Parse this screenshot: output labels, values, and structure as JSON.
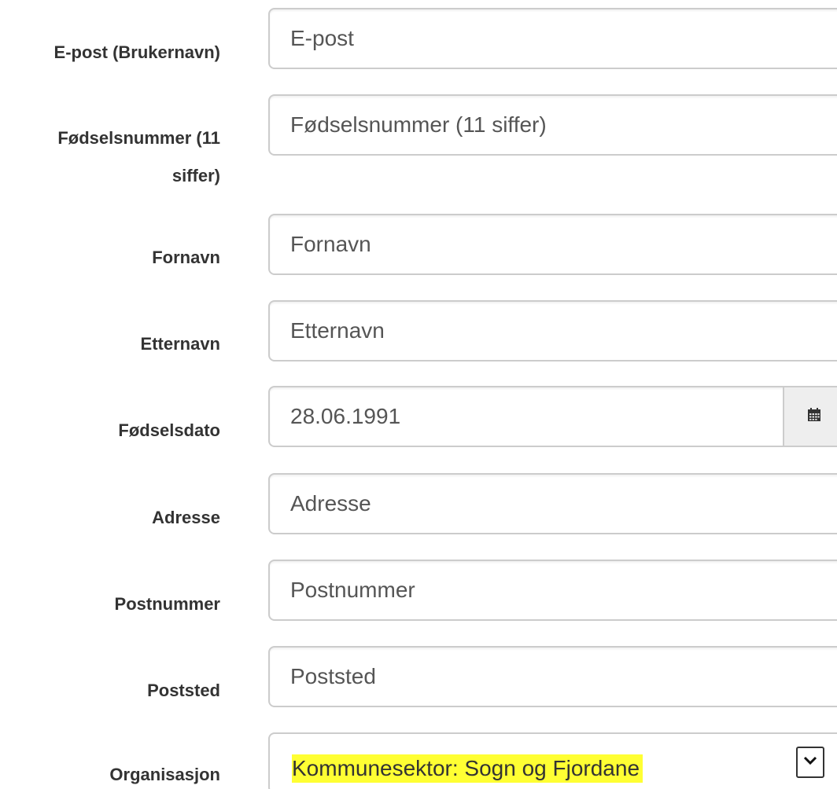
{
  "form": {
    "fields": [
      {
        "id": "email",
        "label": "E-post (Brukernavn)",
        "placeholder": "E-post",
        "value": ""
      },
      {
        "id": "ssn",
        "label": "Fødselsnummer (11 siffer)",
        "placeholder": "Fødselsnummer (11 siffer)",
        "value": ""
      },
      {
        "id": "firstname",
        "label": "Fornavn",
        "placeholder": "Fornavn",
        "value": ""
      },
      {
        "id": "lastname",
        "label": "Etternavn",
        "placeholder": "Etternavn",
        "value": ""
      },
      {
        "id": "birthdate",
        "label": "Fødselsdato",
        "placeholder": "",
        "value": "28.06.1991"
      },
      {
        "id": "address",
        "label": "Adresse",
        "placeholder": "Adresse",
        "value": ""
      },
      {
        "id": "postcode",
        "label": "Postnummer",
        "placeholder": "Postnummer",
        "value": ""
      },
      {
        "id": "city",
        "label": "Poststed",
        "placeholder": "Poststed",
        "value": ""
      },
      {
        "id": "organization",
        "label": "Organisasjon",
        "selected": "Kommunesektor: Sogn og Fjordane"
      }
    ],
    "ssn_label_line1": "Fødselsnummer (11",
    "ssn_label_line2": "siffer)",
    "calendar_icon": "calendar-icon",
    "dropdown_icon": "chevron-down-icon"
  },
  "colors": {
    "highlight": "#ffff33",
    "border": "#cccccc",
    "label_text": "#333333",
    "input_text": "#555555",
    "addon_bg": "#eeeeee"
  }
}
